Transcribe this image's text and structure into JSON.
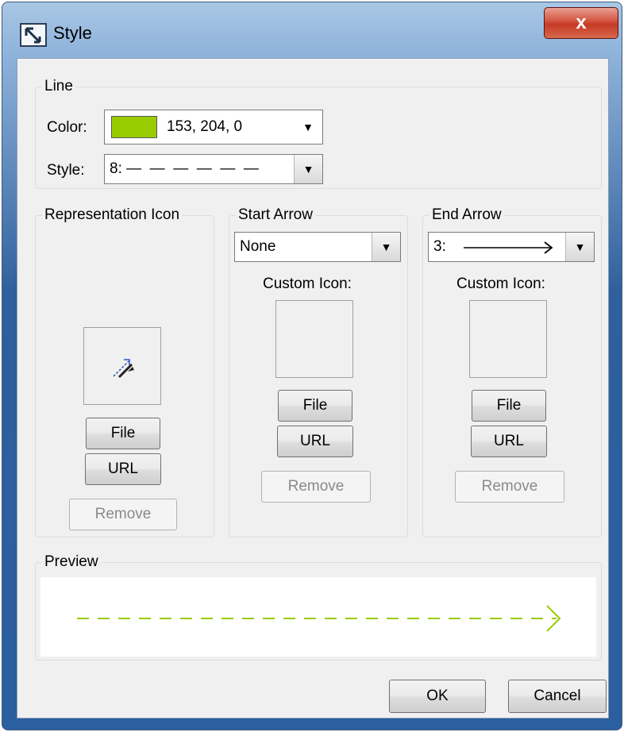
{
  "window": {
    "title": "Style",
    "close_glyph": "x"
  },
  "line": {
    "section_title": "Line",
    "color_label": "Color:",
    "color_value": "153, 204, 0",
    "color_hex": "#99cc00",
    "style_label": "Style:",
    "style_value": "8: —  —  —  —  —  —"
  },
  "representation": {
    "section_title": "Representation Icon",
    "icon": "path-link-icon",
    "file_label": "File",
    "url_label": "URL",
    "remove_label": "Remove"
  },
  "start_arrow": {
    "section_title": "Start Arrow",
    "selected": "None",
    "custom_icon_label": "Custom Icon:",
    "file_label": "File",
    "url_label": "URL",
    "remove_label": "Remove"
  },
  "end_arrow": {
    "section_title": "End Arrow",
    "selected": "3:",
    "custom_icon_label": "Custom Icon:",
    "file_label": "File",
    "url_label": "URL",
    "remove_label": "Remove"
  },
  "preview": {
    "section_title": "Preview",
    "line_color": "#99cc00"
  },
  "footer": {
    "ok_label": "OK",
    "cancel_label": "Cancel"
  },
  "colors": {
    "accent": "#99cc00",
    "close_red": "#c53a25",
    "dialog_bg": "#f0f0f0"
  }
}
